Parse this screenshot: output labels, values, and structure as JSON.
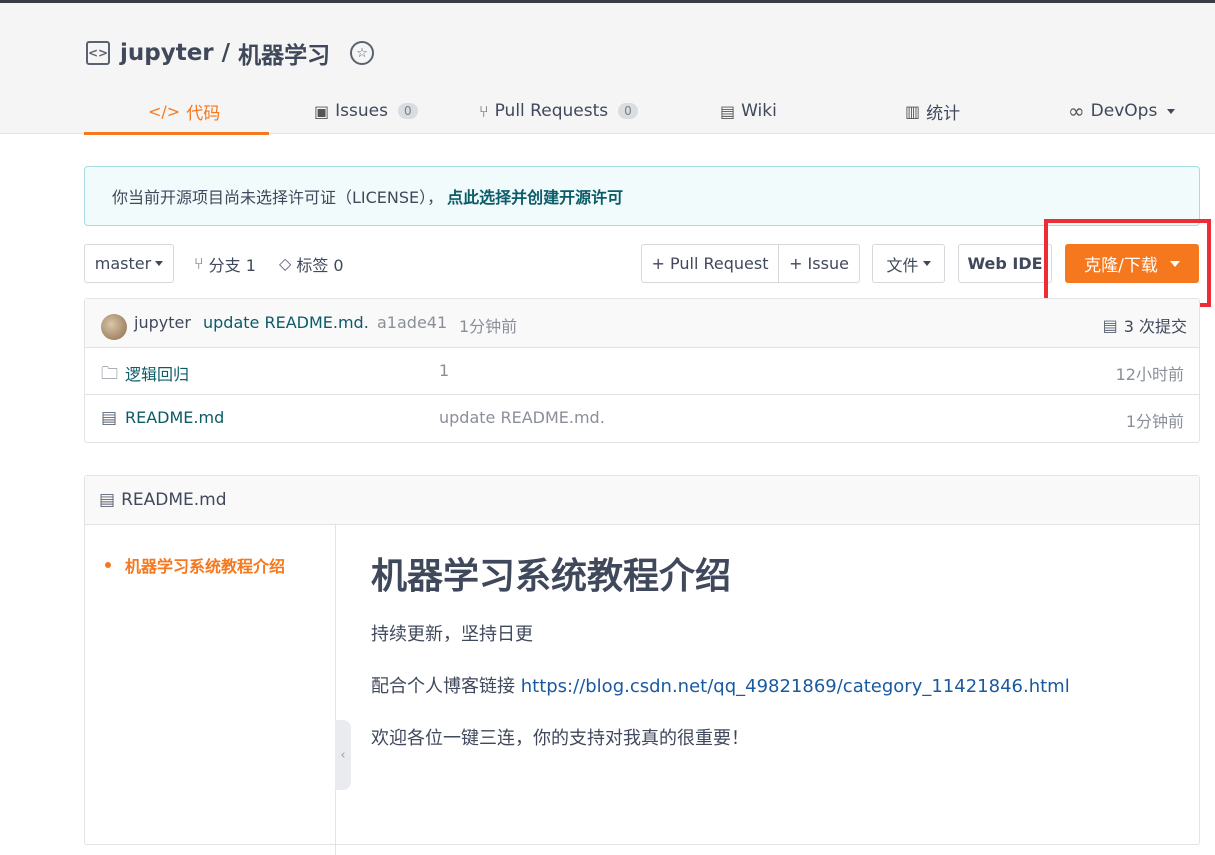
{
  "repo": {
    "owner": "jupyter",
    "separator": "/",
    "name": "机器学习"
  },
  "tabs": [
    {
      "label": "代码",
      "icon": "code-icon"
    },
    {
      "label": "Issues",
      "count": "0",
      "icon": "issues-icon"
    },
    {
      "label": "Pull Requests",
      "count": "0",
      "icon": "pull-request-icon"
    },
    {
      "label": "Wiki",
      "icon": "wiki-icon"
    },
    {
      "label": "统计",
      "icon": "stats-icon"
    },
    {
      "label": "DevOps",
      "icon": "infinity-icon"
    }
  ],
  "notice": {
    "text": "你当前开源项目尚未选择许可证（LICENSE），",
    "link": "点此选择并创建开源许可"
  },
  "toolbar": {
    "branch": "master",
    "branches": "分支 1",
    "tags": "标签 0",
    "pull_request": "+ Pull Request",
    "issue": "+ Issue",
    "file": "文件",
    "web_ide": "Web IDE",
    "clone": "克隆/下载"
  },
  "commit": {
    "author": "jupyter",
    "message": "update README.md.",
    "hash": "a1ade41",
    "time": "1分钟前",
    "total": "3 次提交"
  },
  "files": [
    {
      "name": "逻辑回归",
      "message": "1",
      "time": "12小时前",
      "icon": "folder-icon"
    },
    {
      "name": "README.md",
      "message": "update README.md.",
      "time": "1分钟前",
      "icon": "file-icon"
    }
  ],
  "readme": {
    "filename": "README.md",
    "toc_item": "机器学习系统教程介绍",
    "title": "机器学习系统教程介绍",
    "line1": "持续更新，坚持日更",
    "line2_prefix": "配合个人博客链接 ",
    "line2_link": "https://blog.csdn.net/qq_49821869/category_11421846.html",
    "line3": "欢迎各位一键三连，你的支持对我真的很重要！"
  },
  "colors": {
    "accent": "#f5781e",
    "highlight": "#ec2d35",
    "link": "#0b5b69"
  }
}
